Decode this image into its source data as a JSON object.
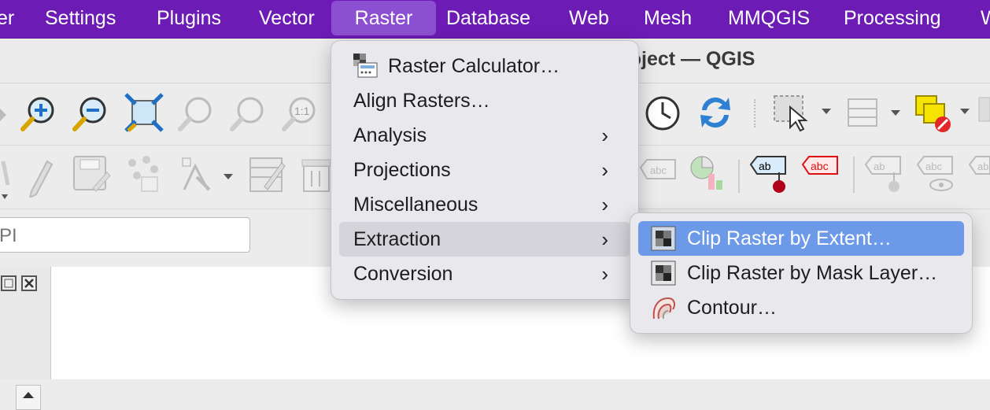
{
  "menubar": {
    "items": [
      "er",
      "Settings",
      "Plugins",
      "Vector",
      "Raster",
      "Database",
      "Web",
      "Mesh",
      "MMQGIS",
      "Processing",
      "W"
    ],
    "active": "Raster"
  },
  "window": {
    "title": "roject — QGIS"
  },
  "search": {
    "placeholder": "PI"
  },
  "raster_menu": {
    "items": [
      {
        "label": "Raster Calculator…",
        "icon": "raster-calculator-icon",
        "submenu": false
      },
      {
        "label": "Align Rasters…",
        "submenu": false
      },
      {
        "label": "Analysis",
        "submenu": true
      },
      {
        "label": "Projections",
        "submenu": true
      },
      {
        "label": "Miscellaneous",
        "submenu": true
      },
      {
        "label": "Extraction",
        "submenu": true,
        "highlighted": true
      },
      {
        "label": "Conversion",
        "submenu": true
      }
    ],
    "chevron": "›"
  },
  "extraction_submenu": {
    "items": [
      {
        "label": "Clip Raster by Extent…",
        "icon": "clip-extent-icon",
        "selected": true
      },
      {
        "label": "Clip Raster by Mask Layer…",
        "icon": "clip-mask-icon"
      },
      {
        "label": "Contour…",
        "icon": "contour-icon"
      }
    ]
  },
  "colors": {
    "menubar": "#6c1bb4",
    "selection": "#6c99e8",
    "highlight": "#d5d4da"
  }
}
